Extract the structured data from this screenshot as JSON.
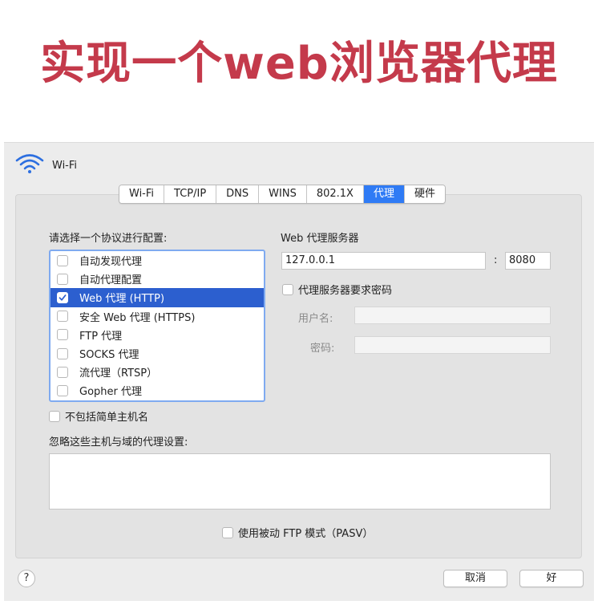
{
  "banner": {
    "title": "实现一个web浏览器代理"
  },
  "window": {
    "title": "Wi-Fi",
    "icon": "wifi-icon"
  },
  "tabs": [
    {
      "label": "Wi-Fi",
      "active": false
    },
    {
      "label": "TCP/IP",
      "active": false
    },
    {
      "label": "DNS",
      "active": false
    },
    {
      "label": "WINS",
      "active": false
    },
    {
      "label": "802.1X",
      "active": false
    },
    {
      "label": "代理",
      "active": true
    },
    {
      "label": "硬件",
      "active": false
    }
  ],
  "protocols": {
    "heading": "请选择一个协议进行配置:",
    "items": [
      {
        "label": "自动发现代理",
        "checked": false,
        "selected": false
      },
      {
        "label": "自动代理配置",
        "checked": false,
        "selected": false
      },
      {
        "label": "Web 代理 (HTTP)",
        "checked": true,
        "selected": true
      },
      {
        "label": "安全 Web 代理 (HTTPS)",
        "checked": false,
        "selected": false
      },
      {
        "label": "FTP 代理",
        "checked": false,
        "selected": false
      },
      {
        "label": "SOCKS 代理",
        "checked": false,
        "selected": false
      },
      {
        "label": "流代理（RTSP）",
        "checked": false,
        "selected": false
      },
      {
        "label": "Gopher 代理",
        "checked": false,
        "selected": false
      }
    ]
  },
  "proxy_server": {
    "heading": "Web 代理服务器",
    "host": "127.0.0.1",
    "separator": ":",
    "port": "8080",
    "requires_password_label": "代理服务器要求密码",
    "requires_password": false,
    "username_label": "用户名:",
    "username": "",
    "password_label": "密码:",
    "password": ""
  },
  "exclude_simple_hostnames": {
    "label": "不包括简单主机名",
    "checked": false
  },
  "bypass": {
    "heading": "忽略这些主机与域的代理设置:",
    "value": ""
  },
  "passive_ftp": {
    "label": "使用被动 FTP 模式（PASV）",
    "checked": false
  },
  "footer": {
    "help_label": "?",
    "cancel_label": "取消",
    "ok_label": "好"
  },
  "colors": {
    "accent": "#2f7bf5",
    "selection": "#2c5fcf",
    "banner": "#c43a4b",
    "wifi_icon": "#2d6fe0"
  }
}
